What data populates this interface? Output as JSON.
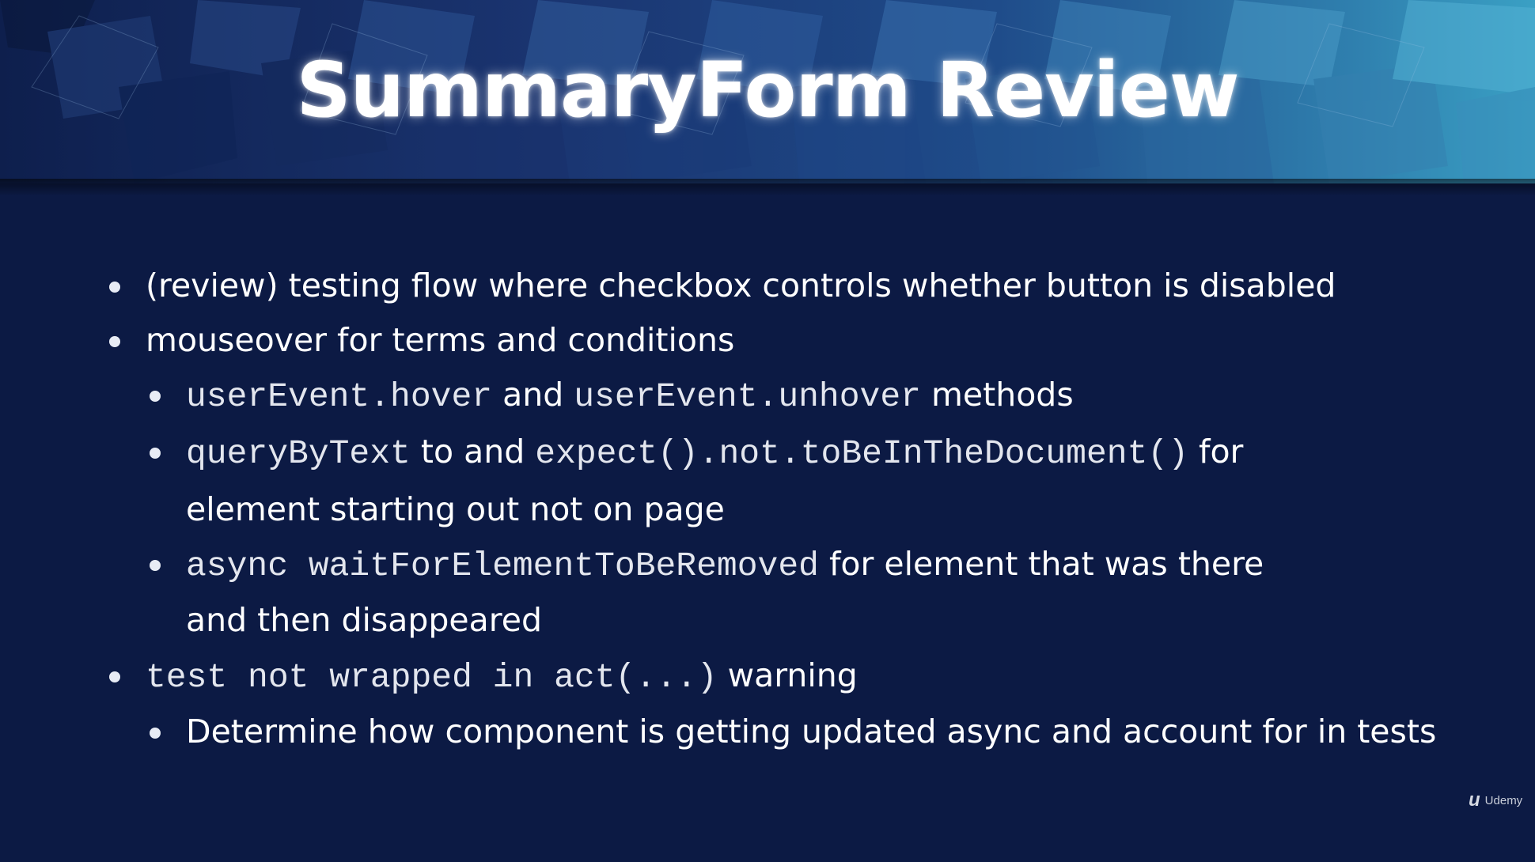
{
  "slide": {
    "title": "SummaryForm Review",
    "bullets": [
      {
        "text": "(review) testing flow where checkbox controls whether button is disabled"
      },
      {
        "text": "mouseover for terms and conditions"
      },
      {
        "code1": "userEvent.hover",
        "mid": " and ",
        "code2": "userEvent.unhover",
        "tail": " methods"
      },
      {
        "code1": "queryByText",
        "mid": " to and ",
        "code2": "expect().not.toBeInTheDocument()",
        "tail": " for",
        "cont": "element starting out not on page"
      },
      {
        "code1": "async waitForElementToBeRemoved",
        "tail": " for element that was there",
        "cont": "and then disappeared"
      },
      {
        "code1": "test not wrapped in act(...)",
        "tail": " warning"
      },
      {
        "text": "Determine how component is getting updated async and account for in tests"
      }
    ],
    "brand": "Udemy",
    "brand_mark": "u",
    "colors": {
      "background": "#0c1a44",
      "text": "#ffffff"
    }
  }
}
